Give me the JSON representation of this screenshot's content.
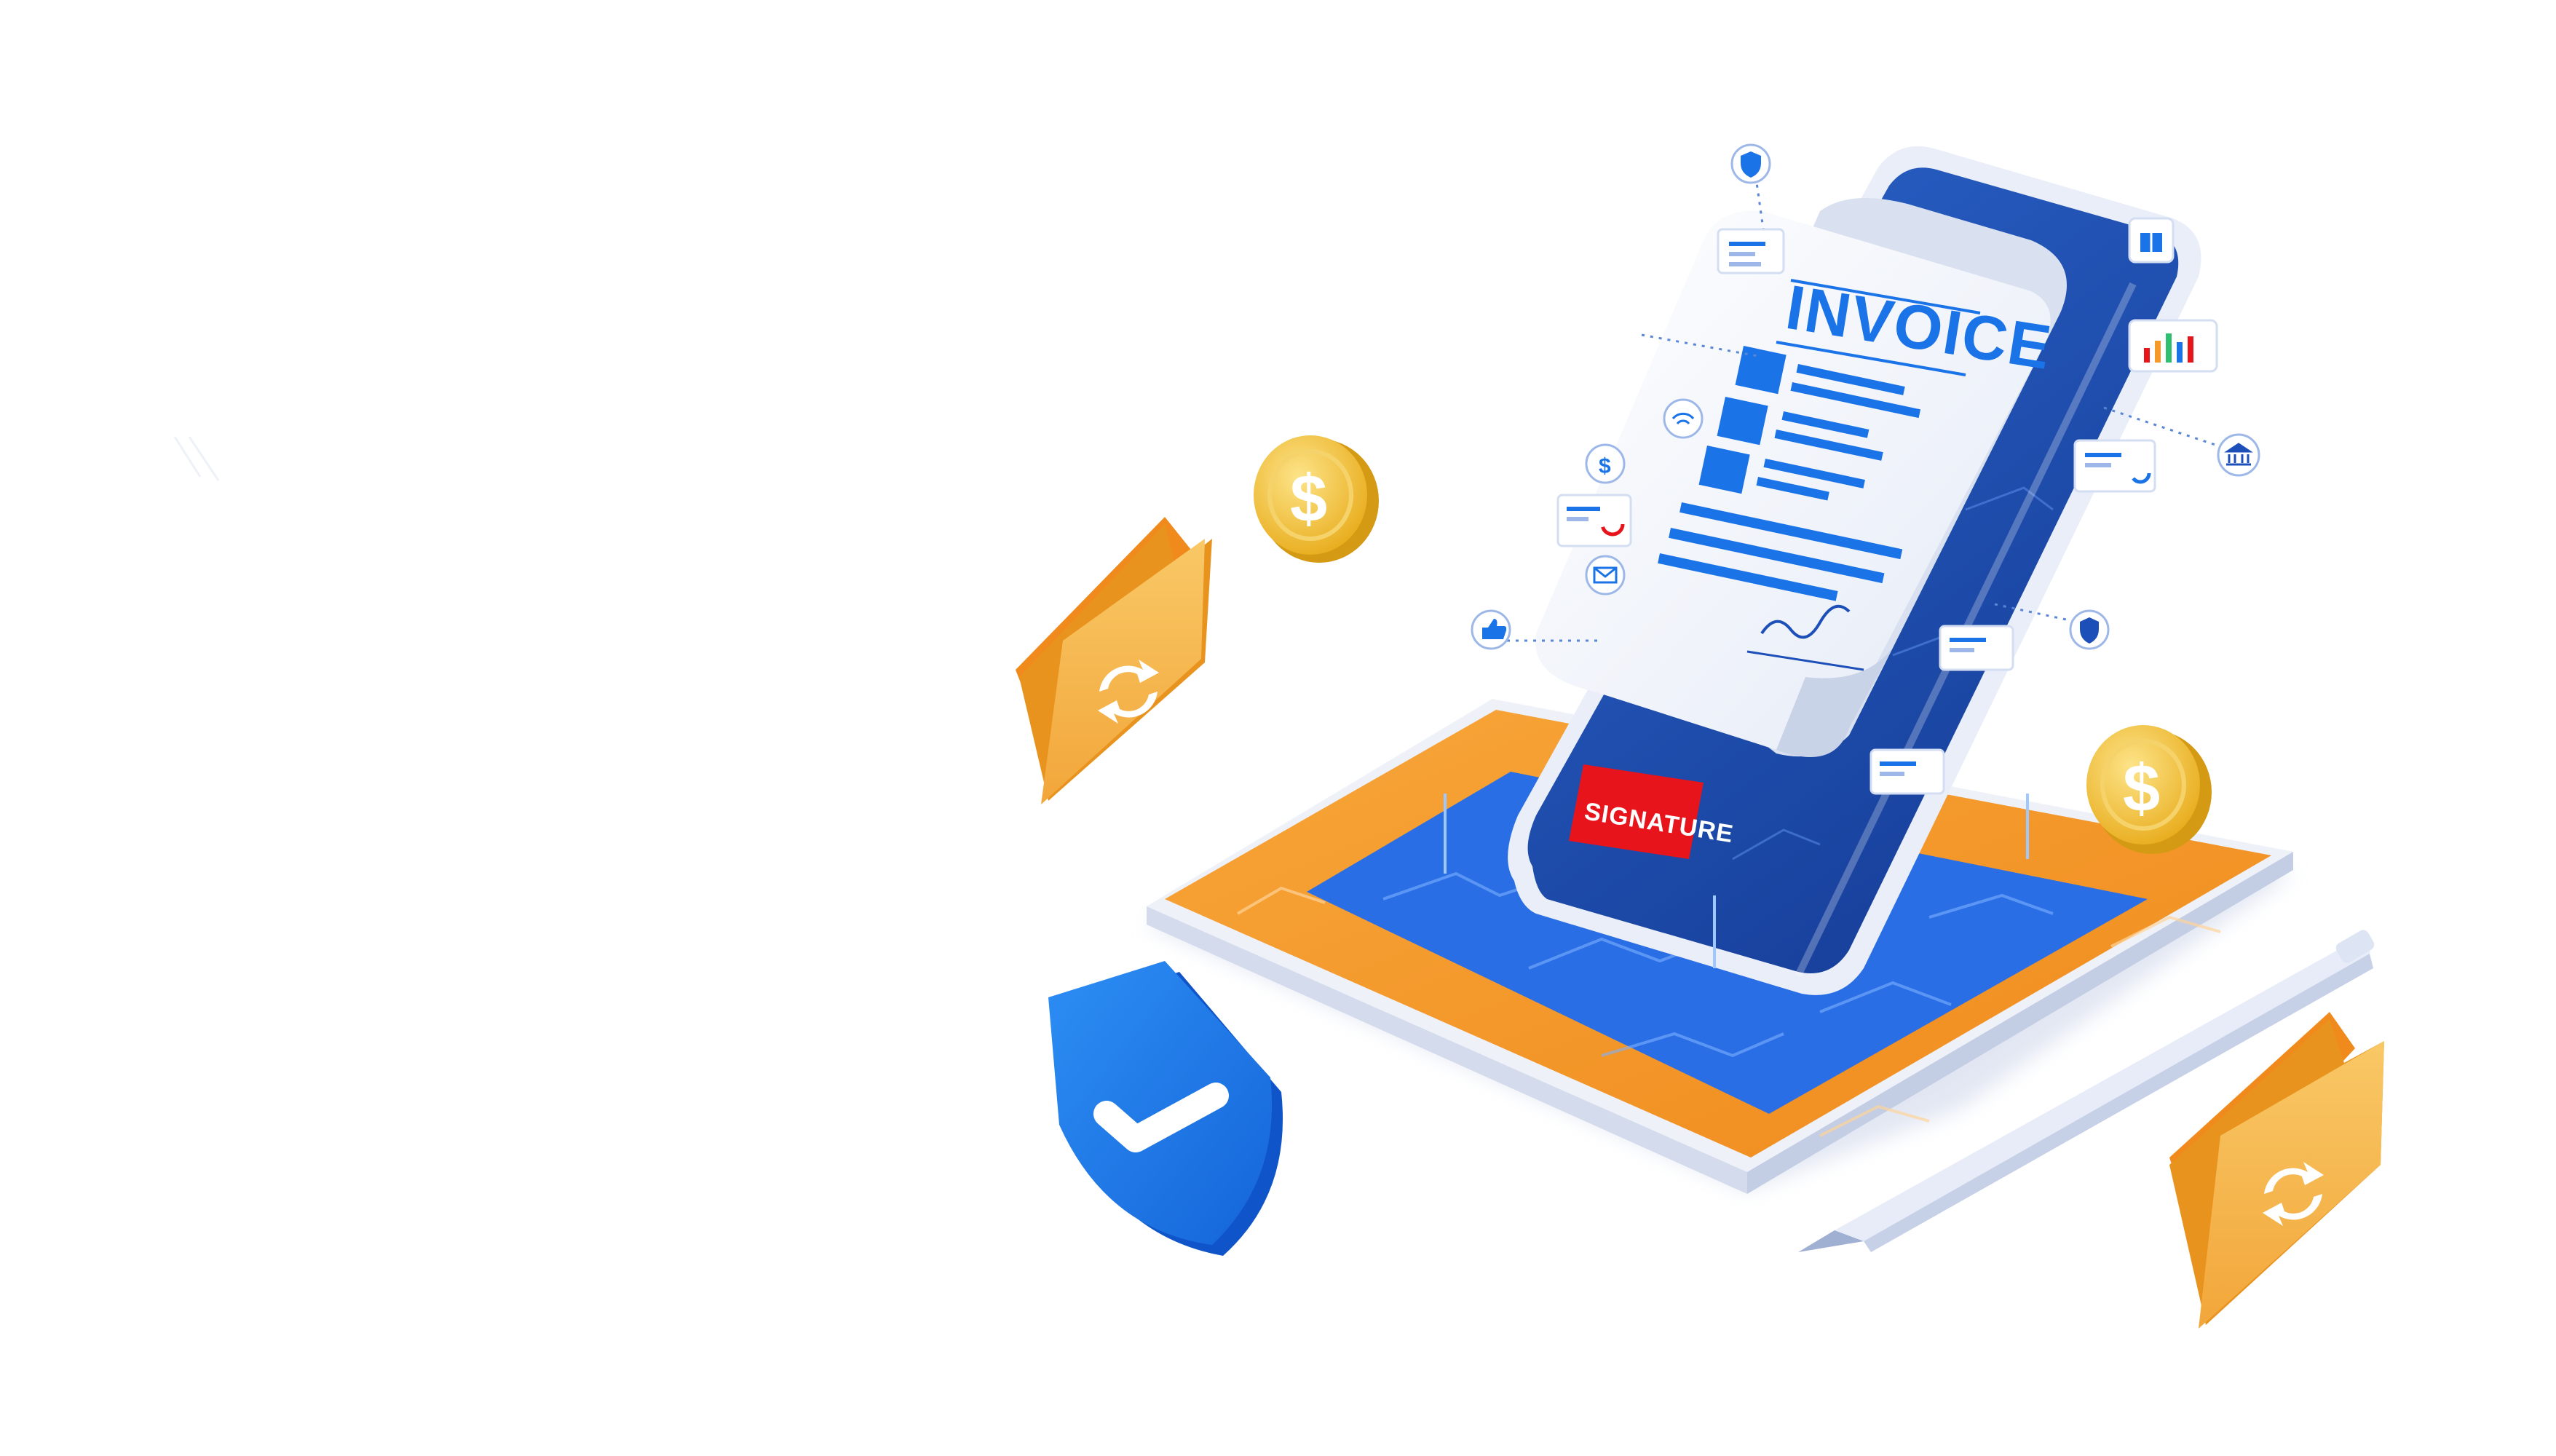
{
  "scene": {
    "invoice_title": "INVOICE",
    "signature_label": "SIGNATURE"
  },
  "colors": {
    "background": "#ffffff",
    "brand_blue": "#1b73e8",
    "deep_blue": "#1d4fb8",
    "orange": "#f39a2b",
    "orange_light": "#f7b24a",
    "folder_yellow": "#f6b84a",
    "coin_gold": "#f2c132",
    "signature_red": "#e8141c",
    "paper": "#f2f5fb"
  },
  "icons": [
    "shield-icon",
    "dollar-icon",
    "wifi-icon",
    "mail-icon",
    "like-icon",
    "bank-icon",
    "chart-icon",
    "gift-icon",
    "security-icon",
    "sync-icon",
    "check-icon"
  ]
}
